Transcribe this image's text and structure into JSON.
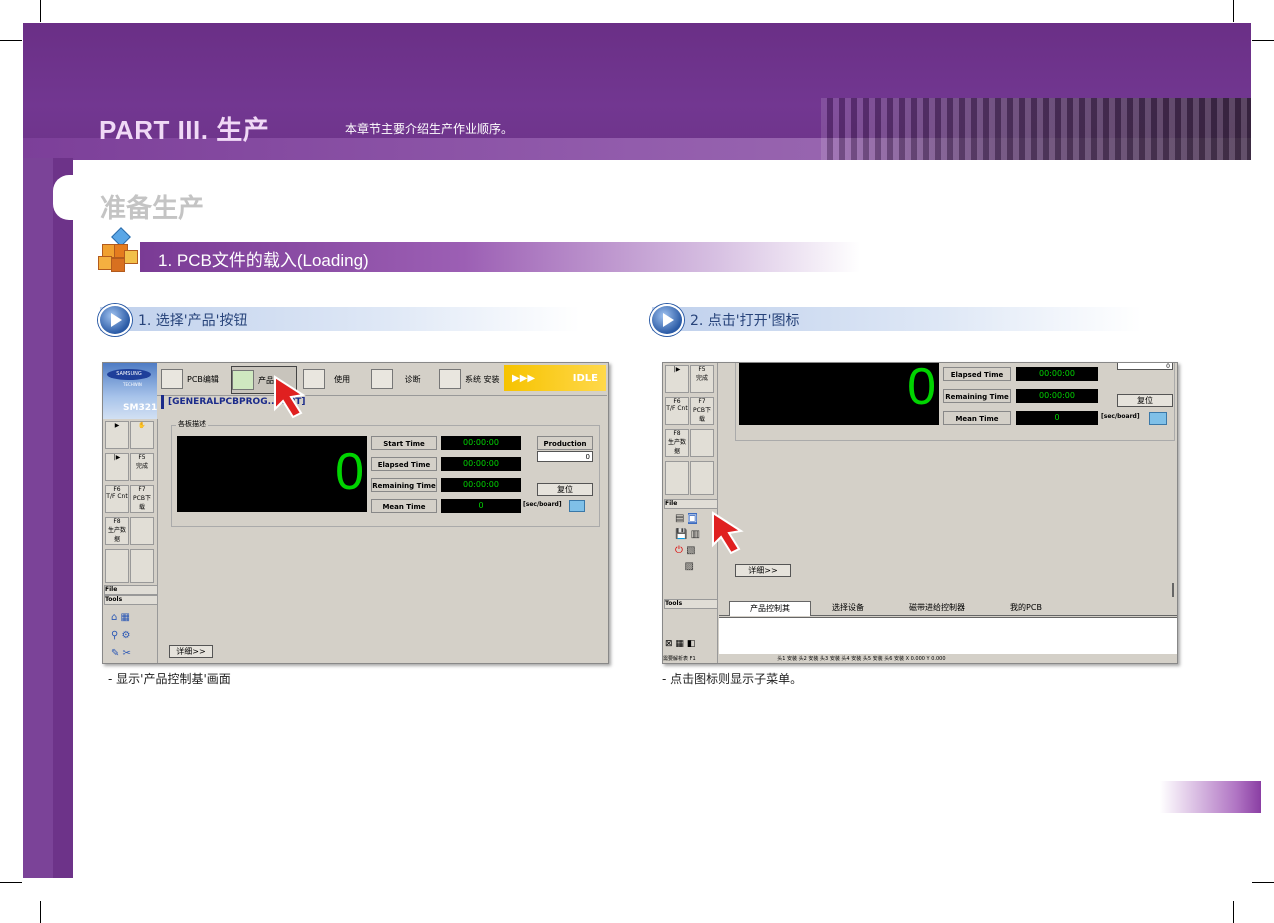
{
  "header": {
    "part_title": "PART III. 生产",
    "part_subtitle": "本章节主要介绍生产作业顺序。"
  },
  "section": {
    "title": "准备生产",
    "step_title": "1. PCB文件的载入(Loading)"
  },
  "steps": [
    {
      "title": "1. 选择'产品'按钮",
      "caption": "- 显示'产品控制基'画面"
    },
    {
      "title": "2. 点击'打开'图标",
      "caption": "- 点击图标则显示子菜单。"
    }
  ],
  "shot1": {
    "brand": "SAMSUNG",
    "brand_sub": "TECHWIN",
    "model": "SM321",
    "toolbar": [
      "PCB编辑",
      "产品",
      "使用",
      "诊断",
      "系统 安装"
    ],
    "status": "IDLE",
    "status_arrows": "▶▶▶",
    "pcb_name": "[GENERALPCBPROG... OPT]",
    "group_label": "各板描述",
    "big_counter": "0",
    "timers": [
      {
        "label": "Start Time",
        "value": "00:00:00"
      },
      {
        "label": "Elapsed Time",
        "value": "00:00:00"
      },
      {
        "label": "Remaining Time",
        "value": "00:00:00"
      },
      {
        "label": "Mean Time",
        "value": "0"
      }
    ],
    "production_plan_label": "Production Plan",
    "production_plan_value": "0",
    "reset_label": "复位",
    "unit": "[sec/board]",
    "side_labels": [
      "F5",
      "完成",
      "F6",
      "F7",
      "T/F Cnt",
      "PCB下载",
      "F8",
      "生产数据"
    ],
    "file_label": "File",
    "tools_label": "Tools",
    "detail_button": "详细>>"
  },
  "shot2": {
    "big_counter": "0",
    "timers": [
      {
        "label": "Elapsed Time",
        "value": "00:00:00"
      },
      {
        "label": "Remaining Time",
        "value": "00:00:00"
      },
      {
        "label": "Mean Time",
        "value": "0"
      }
    ],
    "reset_label": "复位",
    "unit": "[sec/board]",
    "plan_value": "0",
    "side_labels": [
      "F5",
      "完成",
      "F6",
      "F7",
      "T/F Cnt",
      "PCB下载",
      "F8",
      "生产数据"
    ],
    "file_label": "File",
    "tools_label": "Tools",
    "detail_button": "详细>>",
    "tabs": [
      "产品控制其",
      "选择设备",
      "磁带进给控制器",
      "我的PCB"
    ],
    "status_line": "需要解析表 F1",
    "status_cells": [
      "头1",
      "安装",
      "头2",
      "安装",
      "头3",
      "安装",
      "头4",
      "安装",
      "头5",
      "安装",
      "头6",
      "安装"
    ],
    "x_label": "X",
    "x_value": "0.000",
    "y_label": "Y",
    "y_value": "0.000"
  },
  "colors": {
    "banner": "#723791",
    "accent_green": "#00d400",
    "step_blue": "#27437a",
    "status_yellow": "#f6c300"
  }
}
